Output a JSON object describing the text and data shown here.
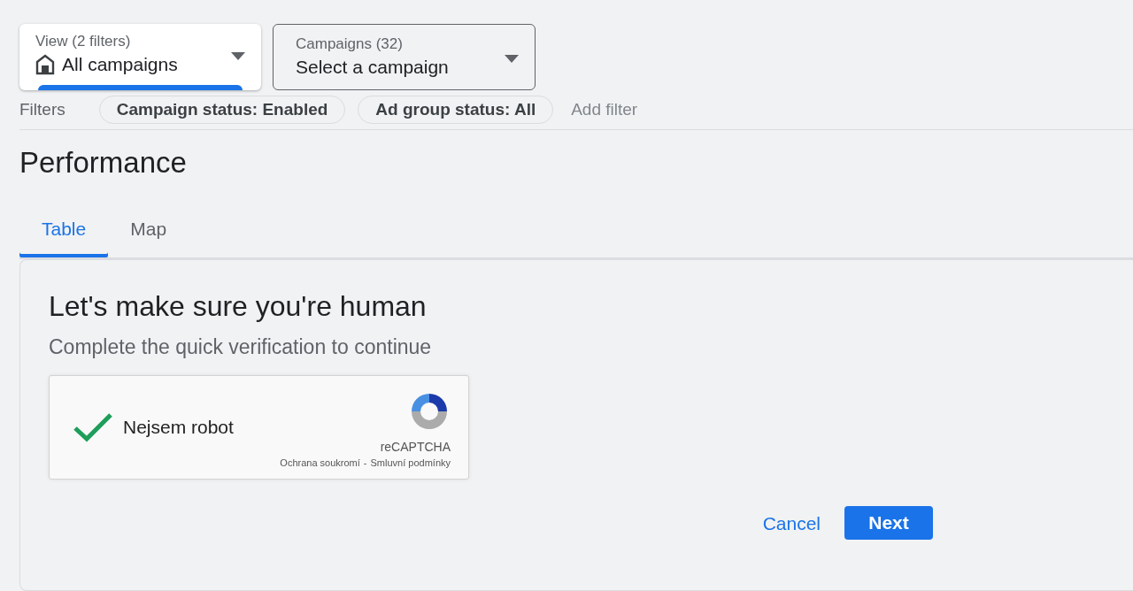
{
  "selectors": [
    {
      "label": "View (2 filters)",
      "value": "All campaigns",
      "kind": "view",
      "selected": true
    },
    {
      "label": "Campaigns (32)",
      "value": "Select a campaign",
      "kind": "campaign",
      "selected": false
    }
  ],
  "filters": {
    "label": "Filters",
    "chips": [
      "Campaign status: Enabled",
      "Ad group status: All"
    ],
    "add": "Add filter"
  },
  "title": "Performance",
  "tabs": [
    {
      "label": "Table",
      "selected": true
    },
    {
      "label": "Map",
      "selected": false
    }
  ],
  "verification": {
    "heading": "Let's make sure you're human",
    "subtitle": "Complete the quick verification to continue",
    "captcha": {
      "label": "Nejsem robot",
      "checked": true,
      "brand": "reCAPTCHA",
      "privacy": "Ochrana soukromí",
      "separator": "-",
      "terms": "Smluvní podmínky"
    },
    "cancel": "Cancel",
    "next": "Next"
  }
}
